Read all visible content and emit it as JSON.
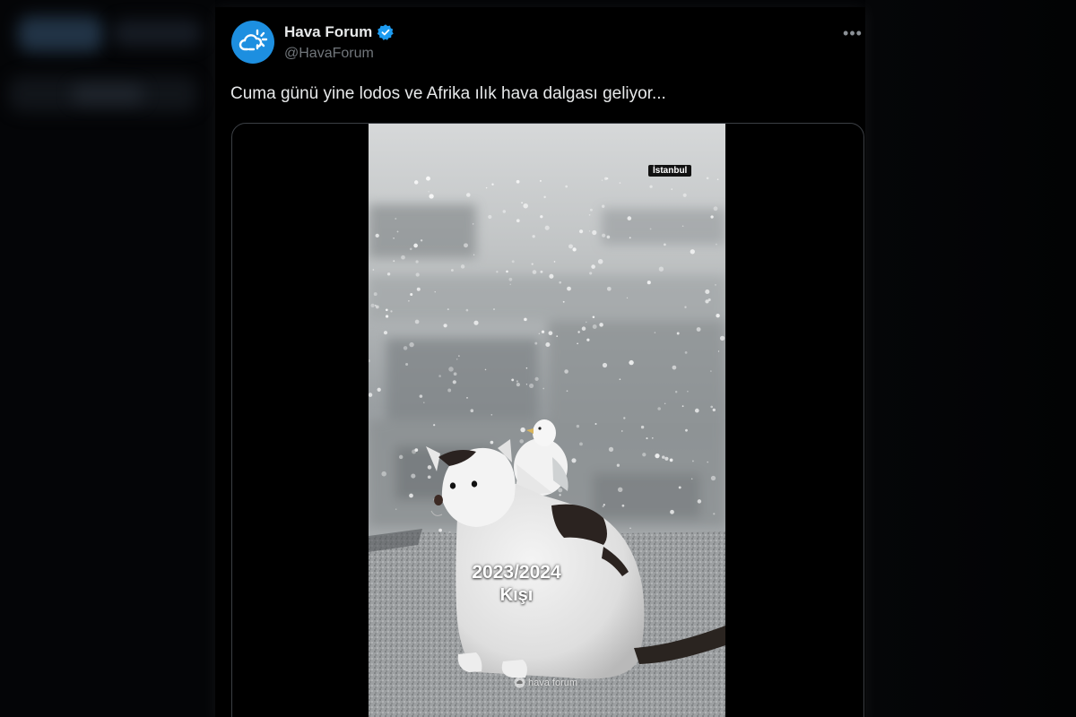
{
  "tweet": {
    "author_name": "Hava Forum",
    "handle": "@HavaForum",
    "text": "Cuma günü yine lodos ve Afrika ılık hava dalgası geliyor...",
    "more_label": "•••",
    "verified": true
  },
  "video": {
    "location_tag": "İstanbul",
    "caption_line1": "2023/2024",
    "caption_line2": "Kışı",
    "watermark": "hava forum"
  },
  "colors": {
    "background": "#000000",
    "accent": "#1d9bf0",
    "text_primary": "#e7e9ea",
    "text_secondary": "#71767b",
    "avatar_bg": "#1d8fe0"
  },
  "icons": {
    "avatar": "cloud-sun-icon",
    "verified": "verified-badge-icon",
    "more": "more-horizontal-icon"
  }
}
